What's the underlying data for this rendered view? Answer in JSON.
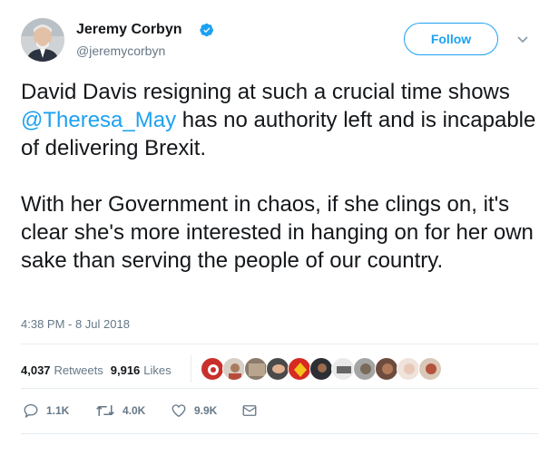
{
  "author": {
    "display_name": "Jeremy Corbyn",
    "handle": "@jeremycorbyn",
    "verified_icon": "verified-badge-icon",
    "avatar_icon": "avatar"
  },
  "header": {
    "follow_label": "Follow",
    "menu_icon": "chevron-down-icon"
  },
  "tweet": {
    "text_part1": "David Davis resigning at such a crucial time shows ",
    "mention": "@Theresa_May",
    "text_part2": " has no authority left and is incapable of delivering Brexit.\n\nWith her Government in chaos, if she clings on, it's clear she's more interested in hanging on for her own sake than serving the people of our country.",
    "timestamp": "4:38 PM - 8 Jul 2018"
  },
  "stats": {
    "retweets_count": "4,037",
    "retweets_label": "Retweets",
    "likes_count": "9,916",
    "likes_label": "Likes"
  },
  "actions": {
    "reply_count": "1.1K",
    "retweet_count": "4.0K",
    "like_count": "9.9K",
    "reply_icon": "reply-icon",
    "retweet_icon": "retweet-icon",
    "like_icon": "heart-icon",
    "dm_icon": "envelope-icon"
  },
  "colors": {
    "accent": "#1da1f2",
    "secondary_text": "#657786",
    "primary_text": "#14171a",
    "divider": "#e6ecf0"
  }
}
